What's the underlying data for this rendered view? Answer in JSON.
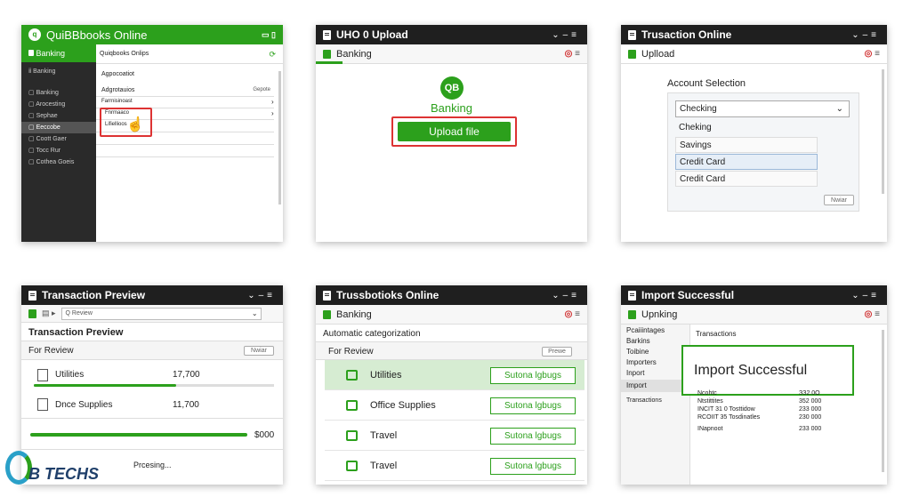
{
  "p1": {
    "title": "QuiBBbooks Online",
    "sidebar_title": "Banking",
    "side_heading": "Banking",
    "side_items": [
      "Banking",
      "Arocesting",
      "Sephae",
      "Eeccobe",
      "Coott Gaer",
      "Tocc Rur",
      "Cothea Goeis"
    ],
    "main_title": "Quiqbooks Onlips",
    "row_a_label": "Agpocoatiot",
    "section_label": "Adgrotauios",
    "section_right": "Gepote",
    "row1": "Farrnisinoast",
    "row2": "Fnrmaaco",
    "row3": "Lifiellioos"
  },
  "p2": {
    "title": "UHO 0 Upload",
    "tab": "Banking",
    "logo": "QB",
    "brand": "Banking",
    "button": "Upload file"
  },
  "p3": {
    "title": "Trusaction Online",
    "tab": "Uplload",
    "heading": "Account Selection",
    "select": "Checking",
    "options": [
      "Cheking",
      "Savings",
      "Credit Card",
      "Credit Card"
    ],
    "button": "Nwiar"
  },
  "p4": {
    "title": "Transaction Preview",
    "search_placeholder": "Q Review",
    "heading": "Transaction Preview",
    "for_review": "For Review",
    "button": "Nwiar",
    "item1_name": "Utilities",
    "item1_amount": "17,700",
    "item2_name": "Dnce Supplies",
    "item2_amount": "11,700",
    "total": "$000",
    "status": "Prcesing..."
  },
  "p5": {
    "title": "Trussbotioks Online",
    "tab": "Banking",
    "heading": "Automatic categorization",
    "for_review": "For Review",
    "button": "Prewe",
    "rows": [
      {
        "name": "Utilities",
        "tag": "Sutona lgbugs"
      },
      {
        "name": "Office Supplies",
        "tag": "Sutona lgbugs"
      },
      {
        "name": "Travel",
        "tag": "Sutona lgbugs"
      },
      {
        "name": "Travel",
        "tag": "Sutona lgbugs"
      }
    ]
  },
  "p6": {
    "title": "Import Successful",
    "tab": "Upnking",
    "side_items": [
      "Pcaiiintages",
      "Barkins",
      "Toibine",
      "Importers",
      "Inport",
      "Import",
      "Transactions"
    ],
    "main_heading": "Transactions",
    "popup": "Import Successful",
    "table": [
      {
        "name": "Ncohtc",
        "amount": "ЗЗ2.0О"
      },
      {
        "name": "Ntstittites",
        "amount": "352 000"
      },
      {
        "name": "INCIT 31 0 Tosttidow",
        "amount": "233 000"
      },
      {
        "name": "RCOIIT 35 Tosdinatles",
        "amount": "230 000"
      },
      {
        "name": "INapnoot",
        "amount": "233 000"
      }
    ]
  },
  "watermark": "B TECHS",
  "colors": {
    "accent": "#2ca01c",
    "highlight": "#d33333",
    "titlebar": "#1f1f1f"
  }
}
